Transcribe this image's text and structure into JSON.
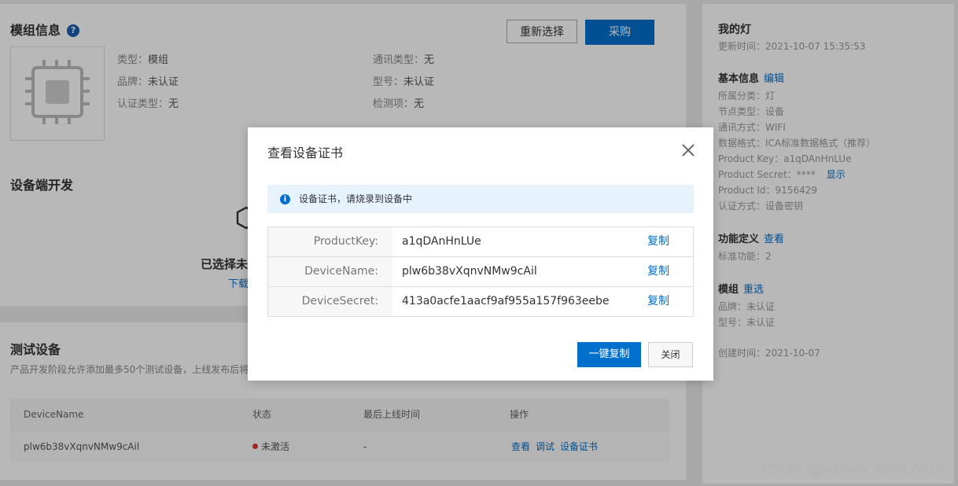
{
  "module": {
    "title": "模组信息",
    "reselect_label": "重新选择",
    "purchase_label": "采购",
    "info": [
      {
        "key": "类型：",
        "value": "模组"
      },
      {
        "key": "品牌：",
        "value": "未认证"
      },
      {
        "key": "认证类型：",
        "value": "无"
      },
      {
        "key": "通讯类型：",
        "value": "无"
      },
      {
        "key": "型号：",
        "value": "未认证"
      },
      {
        "key": "检测项：",
        "value": "无"
      }
    ]
  },
  "device_dev": {
    "title": "设备端开发",
    "partial_text": "已选择未",
    "partial_link": "下载"
  },
  "test_devices": {
    "title": "测试设备",
    "desc": "产品开发阶段允许添加最多50个测试设备，上线发布后将",
    "columns": [
      "DeviceName",
      "状态",
      "最后上线时间",
      "操作"
    ],
    "rows": [
      {
        "name": "plw6b38vXqnvNMw9cAil",
        "status": "未激活",
        "last_online": "-",
        "actions": [
          "查看",
          "调试",
          "设备证书"
        ]
      }
    ]
  },
  "side": {
    "title": "我的灯",
    "updated": "更新时间：2021-10-07 15:35:53",
    "basic_title": "基本信息",
    "basic_edit": "编辑",
    "basic_lines": [
      "所属分类：灯",
      "节点类型：设备",
      "通讯方式：WIFI",
      "数据格式：ICA标准数据格式（推荐）",
      "Product Key：a1qDAnHnLUe",
      "Product Secret：****",
      "Product Id：9156429",
      "认证方式：设备密钥"
    ],
    "secret_show": "显示",
    "func_title": "功能定义",
    "func_view": "查看",
    "func_line": "标准功能：2",
    "mod_title": "模组",
    "mod_reselect": "重选",
    "mod_lines": [
      "品牌：未认证",
      "型号：未认证"
    ],
    "created": "创建时间：2021-10-07"
  },
  "modal": {
    "title": "查看设备证书",
    "alert": "设备证书，请烧录到设备中",
    "credentials": [
      {
        "key": "ProductKey:",
        "value": "a1qDAnHnLUe",
        "copy": "复制"
      },
      {
        "key": "DeviceName:",
        "value": "plw6b38vXqnvNMw9cAil",
        "copy": "复制"
      },
      {
        "key": "DeviceSecret:",
        "value": "413a0acfe1aacf9af955a157f963eebe",
        "copy": "复制"
      }
    ],
    "copy_all_label": "一键复制",
    "close_label": "关闭"
  },
  "watermark": "CSDN @weixin_46417419",
  "colors": {
    "primary": "#0070cc",
    "status_inactive": "#e1352a",
    "alert_bg": "#e6f3fd"
  }
}
